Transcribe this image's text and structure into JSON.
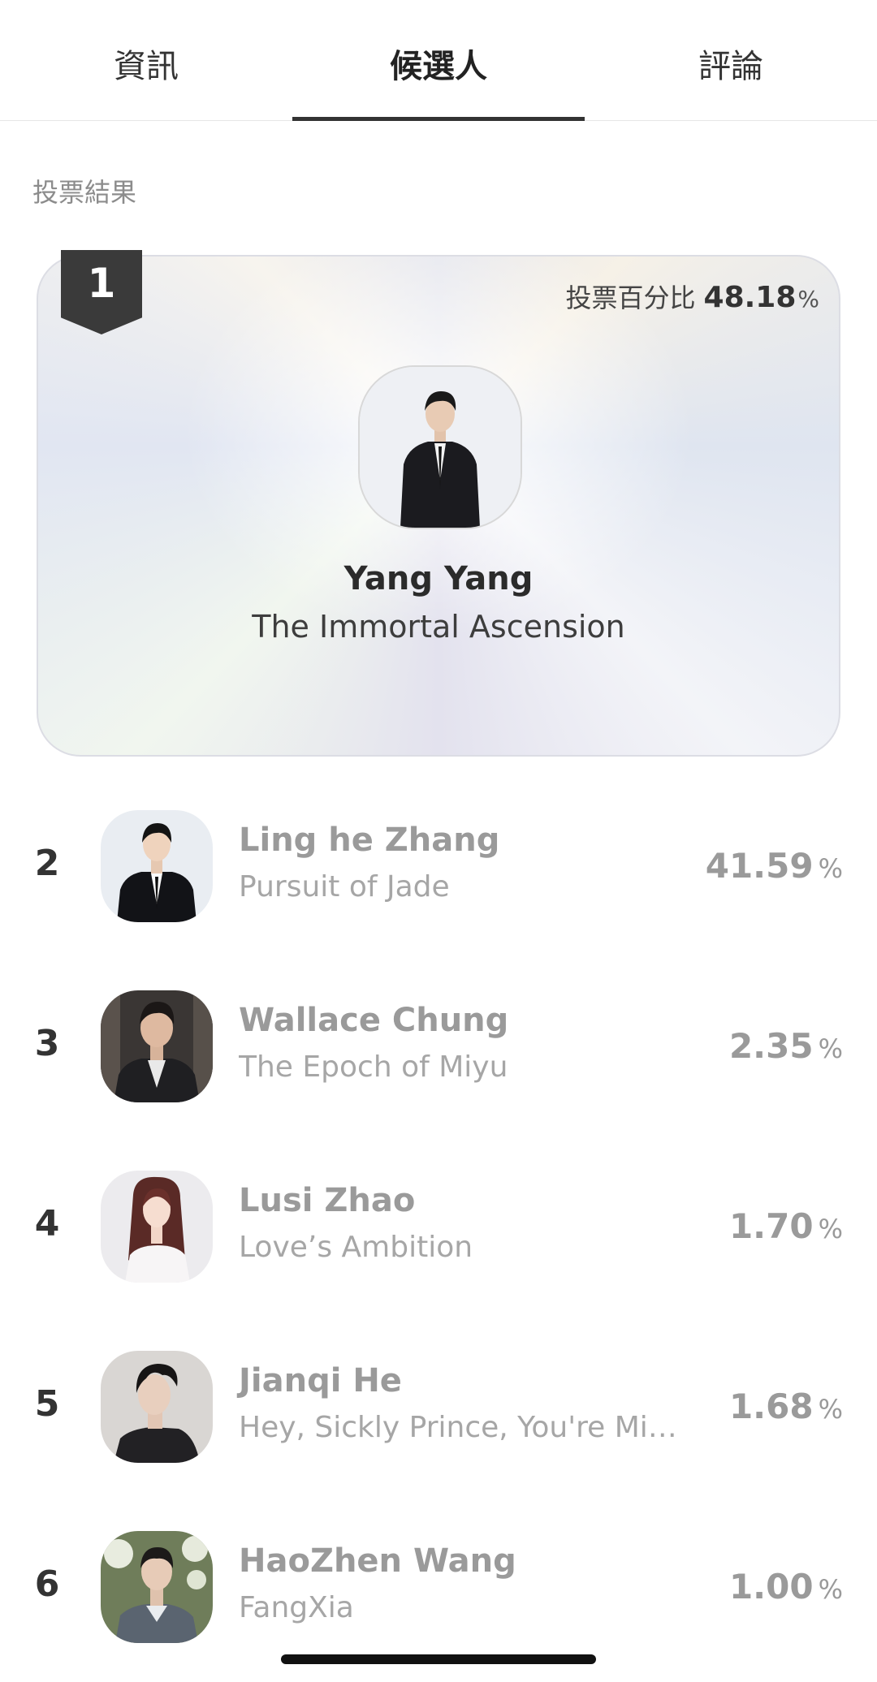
{
  "tabs": [
    {
      "label": "資訊",
      "active": false
    },
    {
      "label": "候選人",
      "active": true
    },
    {
      "label": "評論",
      "active": false
    }
  ],
  "section_label": "投票結果",
  "winner": {
    "rank": "1",
    "percent_label": "投票百分比",
    "percent": "48.18",
    "unit": "%",
    "name": "Yang Yang",
    "work": "The Immortal Ascension"
  },
  "candidates": [
    {
      "rank": "2",
      "name": "Ling he Zhang",
      "work": "Pursuit of Jade",
      "percent": "41.59",
      "unit": "%"
    },
    {
      "rank": "3",
      "name": "Wallace Chung",
      "work": "The Epoch of Miyu",
      "percent": "2.35",
      "unit": "%"
    },
    {
      "rank": "4",
      "name": "Lusi Zhao",
      "work": "Love’s Ambition",
      "percent": "1.70",
      "unit": "%"
    },
    {
      "rank": "5",
      "name": "Jianqi He",
      "work": "Hey, Sickly Prince, You're Min...",
      "percent": "1.68",
      "unit": "%"
    },
    {
      "rank": "6",
      "name": "HaoZhen Wang",
      "work": "FangXia",
      "percent": "1.00",
      "unit": "%"
    }
  ],
  "colors": {
    "accent": "#333333",
    "muted_text": "#9a9a9a",
    "badge": "#3a3a3a"
  }
}
